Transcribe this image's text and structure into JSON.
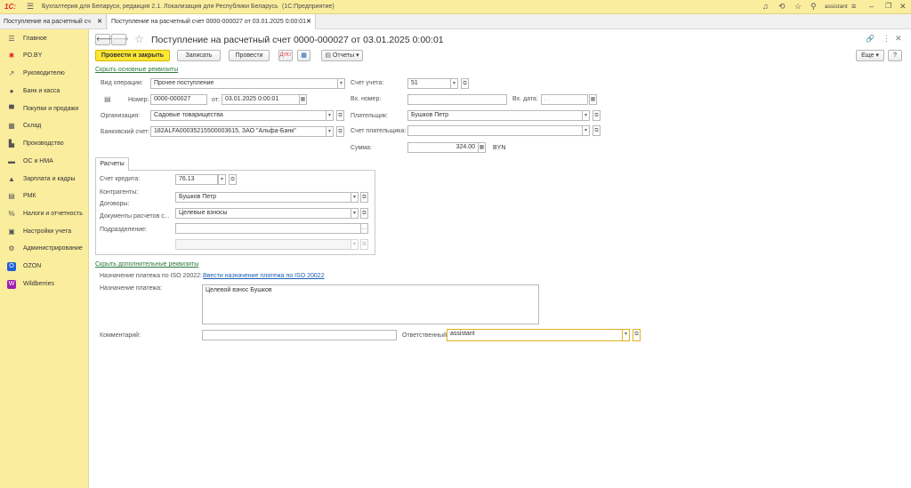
{
  "titlebar": {
    "logo": "1С:",
    "app_title": "Бухгалтерия для Беларуси, редакция 2.1. Локализация для Республики Беларусь",
    "platform": "(1С:Предприятие)",
    "user": "assistant"
  },
  "tabs": [
    {
      "label": "Поступление на расчетный сч"
    },
    {
      "label": "Поступление на расчетный счет 0000-000027 от 03.01.2025 0:00:01"
    }
  ],
  "sidebar": {
    "items": [
      {
        "label": "Главное",
        "icon": "menu-icon"
      },
      {
        "label": "PO.BY",
        "icon": "asterisk-icon"
      },
      {
        "label": "Руководителю",
        "icon": "trend-icon"
      },
      {
        "label": "Банк и касса",
        "icon": "bank-icon"
      },
      {
        "label": "Покупки и продажи",
        "icon": "cart-icon"
      },
      {
        "label": "Склад",
        "icon": "warehouse-icon"
      },
      {
        "label": "Производство",
        "icon": "factory-icon"
      },
      {
        "label": "ОС и НМА",
        "icon": "truck-icon"
      },
      {
        "label": "Зарплата и кадры",
        "icon": "person-icon"
      },
      {
        "label": "РМК",
        "icon": "register-icon"
      },
      {
        "label": "Налоги и отчетность",
        "icon": "tax-icon"
      },
      {
        "label": "Настройки учета",
        "icon": "settings-doc-icon"
      },
      {
        "label": "Администрирование",
        "icon": "gear-icon"
      },
      {
        "label": "OZON",
        "icon": "ozon-icon"
      },
      {
        "label": "Wildberries",
        "icon": "wildberries-icon"
      }
    ]
  },
  "document": {
    "title": "Поступление на расчетный счет 0000-000027 от 03.01.2025 0:00:01"
  },
  "toolbar": {
    "post_close": "Провести и закрыть",
    "save": "Записать",
    "post": "Провести",
    "reports": "Отчеты",
    "more": "Еще",
    "help": "?"
  },
  "links": {
    "hide_main": "Скрыть основные реквизиты",
    "hide_extra": "Скрыть дополнительные реквизиты",
    "iso_link": "Ввести назначение платежа по ISO 20022"
  },
  "form": {
    "operation_label": "Вид операции:",
    "operation_value": "Прочее поступление",
    "number_label": "Номер:",
    "number_value": "0000-000027",
    "from_label": "от:",
    "date_value": "03.01.2025  0:00:01",
    "org_label": "Организация:",
    "org_value": "Садовые товарищества",
    "bank_label": "Банковский счет:",
    "bank_value": "182ALFA00035215500003615, ЗАО \"Альфа-Банк\"",
    "account_label": "Счет учета:",
    "account_value": "51",
    "incoming_no_label": "Вх. номер:",
    "incoming_no_value": "",
    "incoming_date_label": "Вх. дата:",
    "incoming_date_value": " .  .",
    "payer_label": "Плательщик:",
    "payer_value": "Бушков Петр",
    "payer_account_label": "Счет плательщика:",
    "payer_account_value": "",
    "sum_label": "Сумма:",
    "sum_value": "324.00",
    "currency": "BYN"
  },
  "settlements": {
    "tab_label": "Расчеты",
    "credit_account_label": "Счет кредита:",
    "credit_account_value": "76.13",
    "counterparties_label": "Контрагенты:",
    "counterparty_value": "Бушков Петр",
    "contracts_label": "Договоры:",
    "contract_value": "Целевые взносы",
    "settlement_docs_label": "Документы расчетов с...",
    "department_label": "Подразделение:",
    "department_value": "",
    "disabled_value": ""
  },
  "extra": {
    "iso_label": "Назначение платежа по ISO 20022:",
    "purpose_label": "Назначение платежа:",
    "purpose_value": "Целевой взнос Бушков",
    "comment_label": "Комментарий:",
    "comment_value": "",
    "responsible_label": "Ответственный:",
    "responsible_value": "assistant"
  },
  "colors": {
    "chrome_yellow": "#fbed9e",
    "primary_button": "#fde635",
    "link_green": "#2a7a3a",
    "link_blue": "#1a5fb4",
    "logo_red": "#e3262b"
  }
}
